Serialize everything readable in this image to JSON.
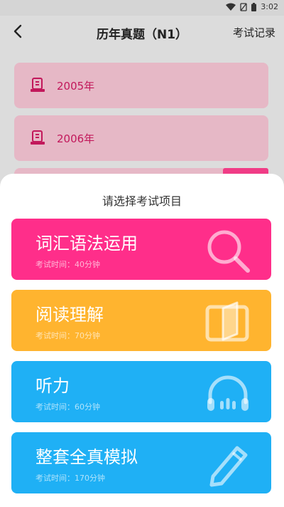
{
  "status": {
    "time": "3:02"
  },
  "header": {
    "title": "历年真题（N1）",
    "record_label": "考试记录"
  },
  "years": [
    {
      "label": "2005年"
    },
    {
      "label": "2006年"
    }
  ],
  "sheet": {
    "title": "请选择考试项目",
    "options": [
      {
        "name": "词汇语法运用",
        "time": "考试时间：40分钟",
        "color": "#ff2e8a",
        "icon": "search-icon"
      },
      {
        "name": "阅读理解",
        "time": "考试时间：70分钟",
        "color": "#ffb42f",
        "icon": "book-icon"
      },
      {
        "name": "听力",
        "time": "考试时间：60分钟",
        "color": "#1fb0f5",
        "icon": "headphones-icon"
      },
      {
        "name": "整套全真模拟",
        "time": "考试时间：170分钟",
        "color": "#1fb0f5",
        "icon": "pencil-icon"
      }
    ]
  }
}
